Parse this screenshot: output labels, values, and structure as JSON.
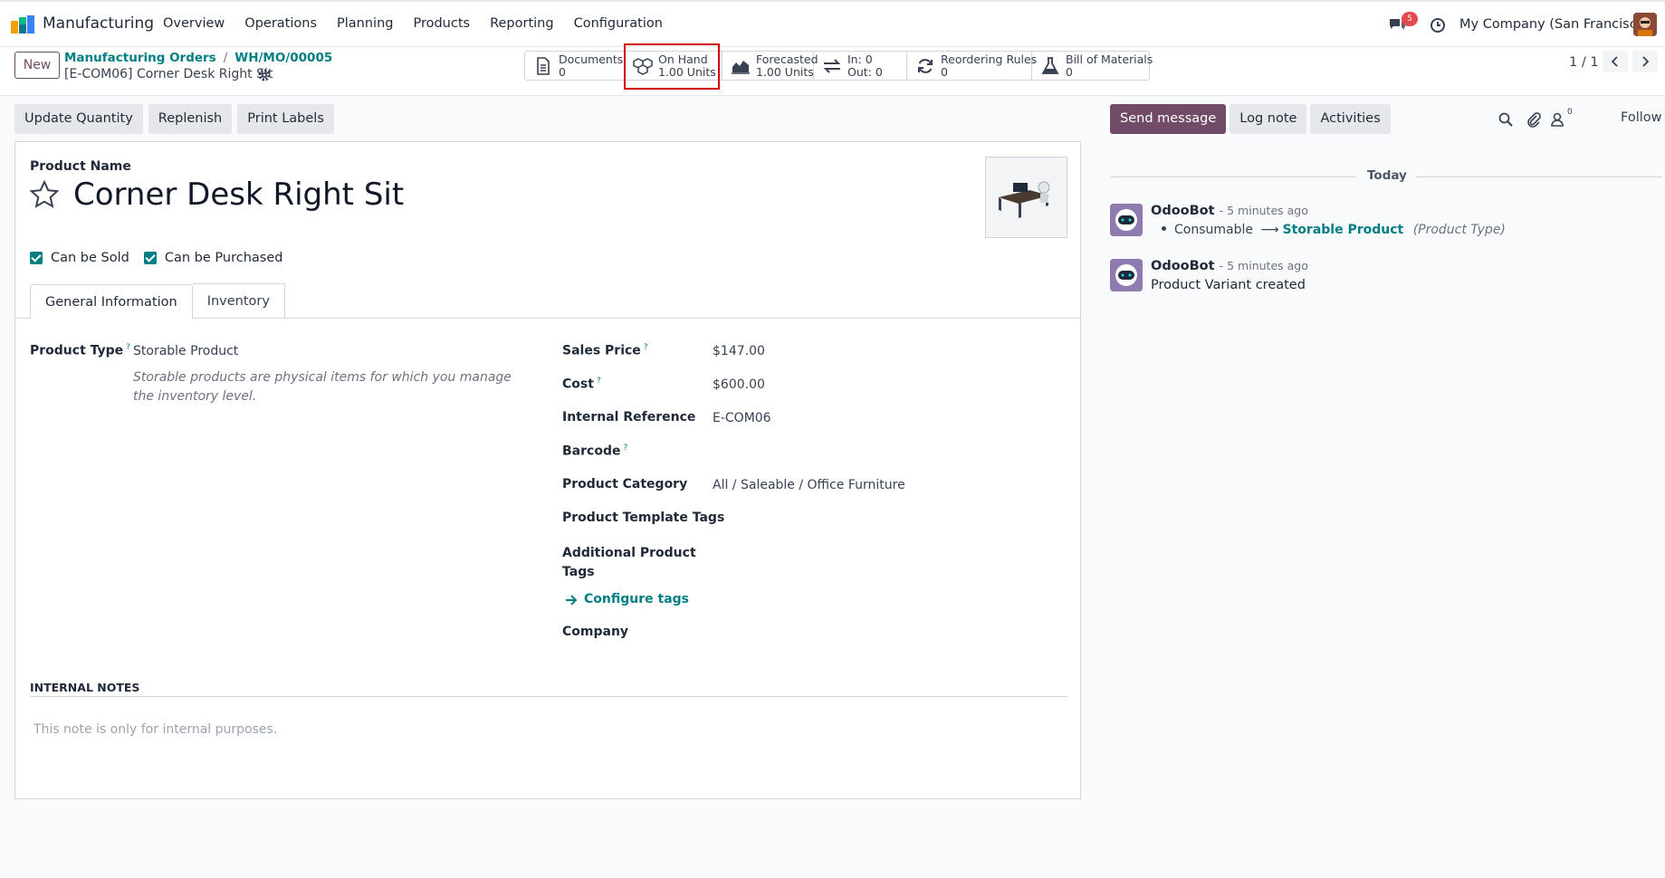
{
  "navbar": {
    "app_name": "Manufacturing",
    "menu": [
      "Overview",
      "Operations",
      "Planning",
      "Products",
      "Reporting",
      "Configuration"
    ],
    "chat_count": "5",
    "company": "My Company (San Francisco)"
  },
  "control": {
    "new_label": "New",
    "breadcrumb": [
      "Manufacturing Orders",
      "WH/MO/00005"
    ],
    "record_title": "[E-COM06] Corner Desk Right Sit",
    "smart_buttons": [
      {
        "line1": "Documents",
        "line2": "0",
        "icon": "document-icon"
      },
      {
        "line1": "On Hand",
        "line2": "1.00 Units",
        "icon": "cubes-icon"
      },
      {
        "line1": "Forecasted",
        "line2": "1.00 Units",
        "icon": "area-chart-icon"
      },
      {
        "line1": "In: 0",
        "line2": "Out: 0",
        "icon": "exchange-icon"
      },
      {
        "line1": "Reordering Rules",
        "line2": "0",
        "icon": "refresh-icon"
      },
      {
        "line1": "Bill of Materials",
        "line2": "0",
        "icon": "flask-icon"
      }
    ],
    "pager": "1 / 1"
  },
  "actions": [
    "Update Quantity",
    "Replenish",
    "Print Labels"
  ],
  "form": {
    "product_name_label": "Product Name",
    "product_name": "Corner Desk Right Sit",
    "can_be_sold": "Can be Sold",
    "can_be_purchased": "Can be Purchased",
    "tabs": [
      "General Information",
      "Inventory"
    ],
    "product_type_label": "Product Type",
    "product_type": "Storable Product",
    "product_type_help": "Storable products are physical items for which you manage the inventory level.",
    "sales_price_label": "Sales Price",
    "sales_price": "$147.00",
    "cost_label": "Cost",
    "cost": "$600.00",
    "internal_ref_label": "Internal Reference",
    "internal_ref": "E-COM06",
    "barcode_label": "Barcode",
    "category_label": "Product Category",
    "category": "All / Saleable / Office Furniture",
    "template_tags_label": "Product Template Tags",
    "additional_tags_label_1": "Additional Product",
    "additional_tags_label_2": "Tags",
    "configure_tags": "Configure tags",
    "company_label": "Company",
    "notes_heading": "INTERNAL NOTES",
    "notes_placeholder": "This note is only for internal purposes.",
    "help_mark": "?"
  },
  "chatter": {
    "send_message": "Send message",
    "log_note": "Log note",
    "activities": "Activities",
    "followers_count": "0",
    "follow": "Follow",
    "today": "Today",
    "messages": [
      {
        "author": "OdooBot",
        "ago": "- 5 minutes ago",
        "old_value": "Consumable",
        "new_value": "Storable Product",
        "field": "(Product Type)"
      },
      {
        "author": "OdooBot",
        "ago": "- 5 minutes ago",
        "body": "Product Variant created"
      }
    ]
  },
  "colors": {
    "brand": "#714b67",
    "accent": "#017e84",
    "highlight": "#d40000",
    "badge": "#e5484d"
  }
}
